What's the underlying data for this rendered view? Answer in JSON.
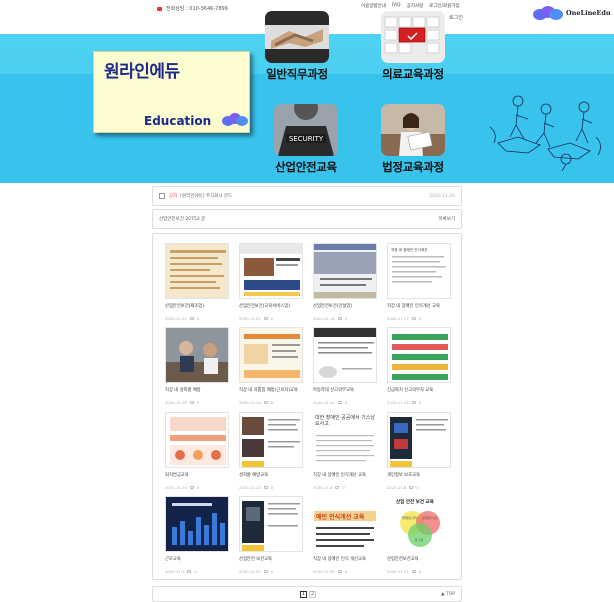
{
  "topbar": {
    "tagline": "전화상담 : 010-3646-7899",
    "links": [
      "이용방법안내",
      "FAQ",
      "공지사항",
      "로그인/회원가입"
    ],
    "login": "로그인"
  },
  "logo": {
    "text": "OneLineEdu"
  },
  "brand": {
    "title_kr": "원라인에듀",
    "title_en": "Education"
  },
  "categories": [
    {
      "label": "일반직무과정",
      "icon": "handshake-photo-icon"
    },
    {
      "label": "의료교육과정",
      "icon": "keyboard-red-key-photo-icon"
    },
    {
      "label": "산업안전교육",
      "icon": "security-guard-photo-icon"
    },
    {
      "label": "법정교육과정",
      "icon": "reading-woman-photo-icon"
    }
  ],
  "notice": {
    "badge": "공지",
    "title": "[원라인에듀] 주식회사 찬드",
    "date": "2020.11.24"
  },
  "board": {
    "title": "산업안전보건 20753 글",
    "right": "목록보기"
  },
  "posts": [
    {
      "title": "산업안전보건(제조업)",
      "date": "2020.11.22",
      "comments": "0"
    },
    {
      "title": "산업안전보건(교육서비스업)",
      "date": "2020.11.21",
      "comments": "0"
    },
    {
      "title": "산업안전보건(건설업)",
      "date": "2020.11.18",
      "comments": "0"
    },
    {
      "title": "직장 내 장애인 인식개선 교육",
      "date": "2020.11.17",
      "comments": "0"
    },
    {
      "title": "직장 내 성희롱 예방",
      "date": "2020.11.16",
      "comments": "0"
    },
    {
      "title": "직장 내 괴롭힘 예방(근로자)교육",
      "date": "2020.11.14",
      "comments": "0"
    },
    {
      "title": "아동학대 신고의무교육",
      "date": "2020.11.11",
      "comments": "0"
    },
    {
      "title": "긴급복지 신고의무자 교육",
      "date": "2020.11.11",
      "comments": "0"
    },
    {
      "title": "퇴직연금교육",
      "date": "2020.11.10",
      "comments": "0"
    },
    {
      "title": "성희롱 예방교육",
      "date": "2020.11.10",
      "comments": "0"
    },
    {
      "title": "직장 내 장애인 인식개선 교육",
      "date": "2020.11.9",
      "comments": "0"
    },
    {
      "title": "개인정보 보호교육",
      "date": "2020.11.8",
      "comments": "0"
    },
    {
      "title": "근로교육",
      "date": "2020.11.3",
      "comments": "0"
    },
    {
      "title": "산업안전 보건교육",
      "date": "2020.11.31",
      "comments": "0"
    },
    {
      "title": "직장 내 장애인 인식 개선교육",
      "date": "2020.11.30",
      "comments": "0"
    },
    {
      "title": "산업안전보건교육",
      "date": "2020.11.21",
      "comments": "0"
    }
  ],
  "thumb_text": {
    "p4": "직장 내 장애인 인식개선",
    "p11": "대한 장애인 공공에서 기스낭 요사고",
    "p13": "애인 인식개선 교육",
    "p16": "산업 안전 보건 교육",
    "p16_c1": "작업환경 관리",
    "p16_c2": "산업안전 보건",
    "p16_c3": "법 교육"
  },
  "pager": {
    "pages": [
      "1",
      "2"
    ],
    "top": "▲ TOP"
  },
  "colors": {
    "band": "#3bc6ee",
    "brand_blue": "#1a2a8a",
    "card_bg": "#fdfbd0"
  }
}
